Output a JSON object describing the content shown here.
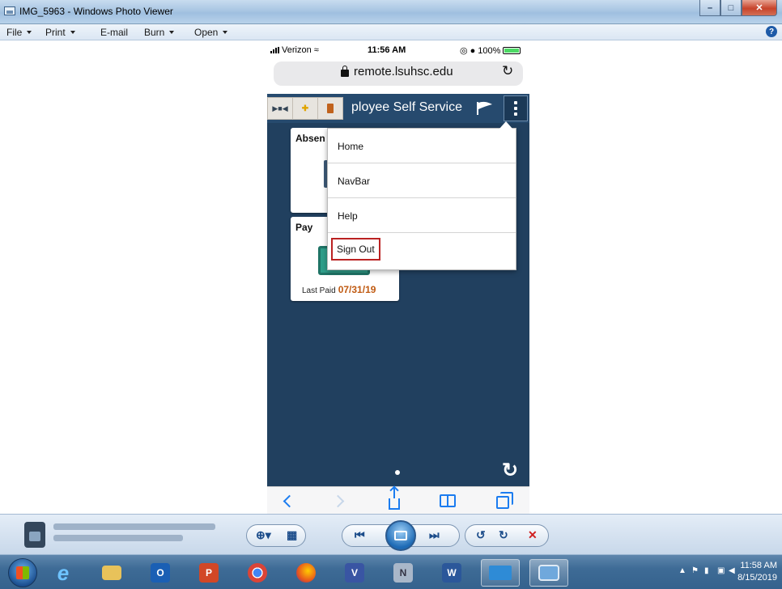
{
  "window": {
    "title": "IMG_5963 - Windows Photo Viewer"
  },
  "menubar": {
    "items": [
      "File",
      "Print",
      "E-mail",
      "Burn",
      "Open"
    ]
  },
  "phone": {
    "status": {
      "carrier": "Verizon",
      "time": "11:56 AM",
      "battery": "100%",
      "battery_level": 1.0
    },
    "url": "remote.lsuhsc.edu",
    "header_title": "ployee Self Service",
    "tiles": {
      "absence_title": "Absen",
      "pay_title": "Pay",
      "last_paid_label": "Last Paid",
      "last_paid_date": "07/31/19"
    },
    "action_menu": {
      "items": [
        "Home",
        "NavBar",
        "Help",
        "Sign Out"
      ]
    }
  },
  "taskbar": {
    "clock_time": "11:58 AM",
    "clock_date": "8/15/2019"
  },
  "colors": {
    "app_bg": "#21405f",
    "header_bg": "#264a6e",
    "highlight_border": "#bb2222",
    "last_paid_date": "#c05a11",
    "tile_graphic": "#2f9e8a"
  },
  "icons": {
    "taskbar": [
      "internet-explorer-icon",
      "file-explorer-icon",
      "outlook-icon",
      "powerpoint-icon",
      "chrome-icon",
      "firefox-icon",
      "visio-icon",
      "onenote-icon",
      "word-icon",
      "remote-desktop-icon",
      "photo-viewer-icon"
    ]
  }
}
